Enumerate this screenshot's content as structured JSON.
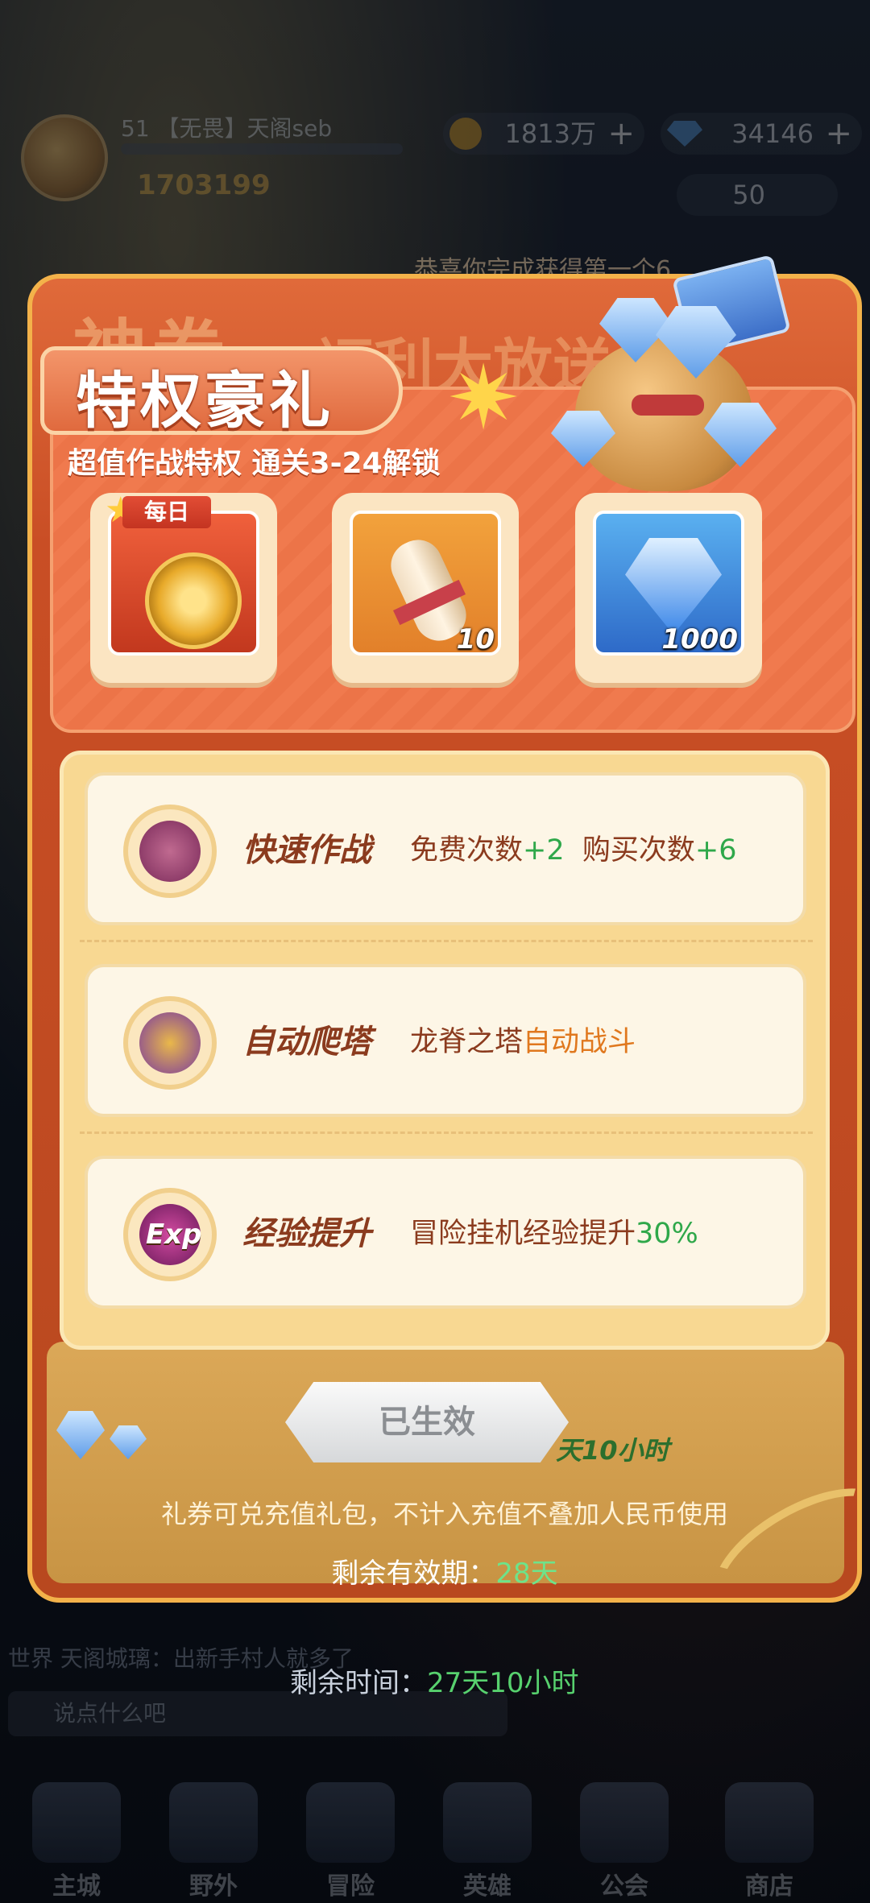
{
  "hud": {
    "player_name": "51 【无畏】天阁seb",
    "power": "1703199",
    "gold": "1813万",
    "diamonds": "34146",
    "scroll_count": "50",
    "notice": "恭喜你完成获得第一个6"
  },
  "background_banner": {
    "title_left": "神券",
    "title_right": "福利大放送"
  },
  "modal": {
    "title": "特权豪礼",
    "subtitle": "超值作战特权 通关3-24解锁",
    "rewards": [
      {
        "icon": "quick-battle-compass-icon",
        "tag": "每日",
        "quantity": ""
      },
      {
        "icon": "scroll-icon",
        "tag": "",
        "quantity": "10"
      },
      {
        "icon": "diamond-icon",
        "tag": "",
        "quantity": "1000"
      }
    ],
    "privileges": [
      {
        "icon": "quick-battle-icon",
        "title": "快速作战",
        "desc_a": "免费次数",
        "val_a": "+2",
        "desc_b": "购买次数",
        "val_b": "+6"
      },
      {
        "icon": "tower-icon",
        "title": "自动爬塔",
        "desc_a": "龙脊之塔",
        "val_a": "自动战斗"
      },
      {
        "icon": "exp-icon",
        "icon_text": "Exp",
        "title": "经验提升",
        "desc_a": "冒险挂机经验提升",
        "val_a": "30%"
      }
    ],
    "status_button": "已生效",
    "behind_time": "天10小时",
    "voucher_note": "礼券可兑充值礼包，不计入充值不叠加人民币使用",
    "validity_label": "剩余有效期：",
    "validity_value": "28天"
  },
  "remaining_label": "剩余时间：",
  "remaining_value": "27天10小时",
  "chat": {
    "channel": "世界",
    "message": "天阁城璃：出新手村人就多了",
    "input_placeholder": "说点什么吧"
  },
  "nav": [
    "主城",
    "野外",
    "冒险",
    "英雄",
    "公会",
    "商店"
  ],
  "colors": {
    "accent_orange": "#e06a3a",
    "green": "#2fa84a",
    "gold": "#f3b24a"
  }
}
